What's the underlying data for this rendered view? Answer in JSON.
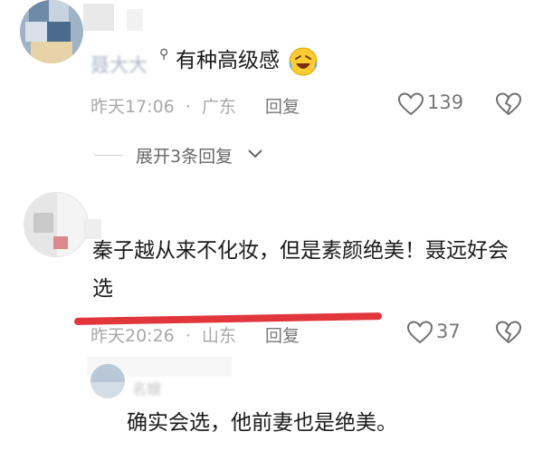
{
  "comment1": {
    "username": "聂大大",
    "text": "有种高级感",
    "emoji": "laughing-tears-emoji",
    "time": "昨天17:06",
    "separator": "·",
    "location": "广东",
    "reply_label": "回复",
    "like_count": "139"
  },
  "expand_replies": {
    "label": "展开3条回复"
  },
  "comment2": {
    "text": "秦子越从来不化妆，但是素颜绝美！聂远好会选",
    "time": "昨天20:26",
    "separator": "·",
    "location": "山东",
    "reply_label": "回复",
    "like_count": "37"
  },
  "comment3": {
    "username": "名嫂",
    "text": "确实会选，他前妻也是绝美。"
  },
  "colors": {
    "annotation_line": "#e0363c",
    "meta_text": "#a8a8a8",
    "icon": "#6f6f6f"
  }
}
